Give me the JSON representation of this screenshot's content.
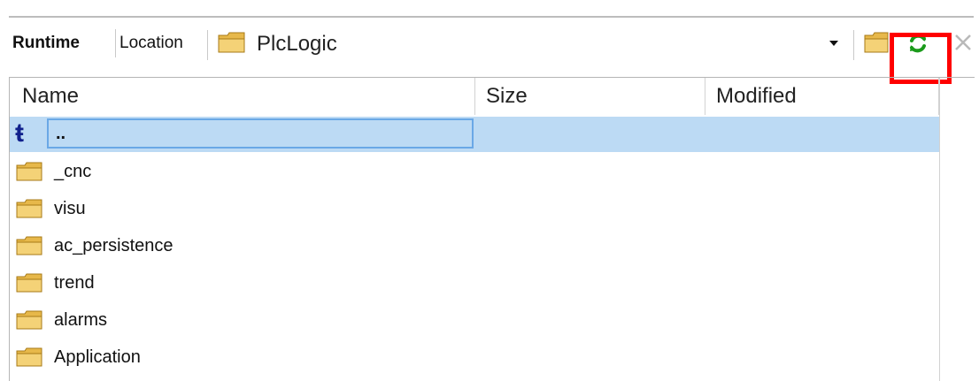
{
  "toolbar": {
    "tab_runtime": "Runtime",
    "tab_location": "Location",
    "path": "PlcLogic",
    "colors": {
      "refresh": "#1b9a1b",
      "highlight": "#ff0000"
    }
  },
  "table": {
    "headers": {
      "name": "Name",
      "size": "Size",
      "modified": "Modified"
    },
    "up_row": {
      "name": ".."
    },
    "rows": [
      {
        "name": "_cnc"
      },
      {
        "name": "visu"
      },
      {
        "name": "ac_persistence"
      },
      {
        "name": "trend"
      },
      {
        "name": "alarms"
      },
      {
        "name": "Application"
      }
    ]
  }
}
